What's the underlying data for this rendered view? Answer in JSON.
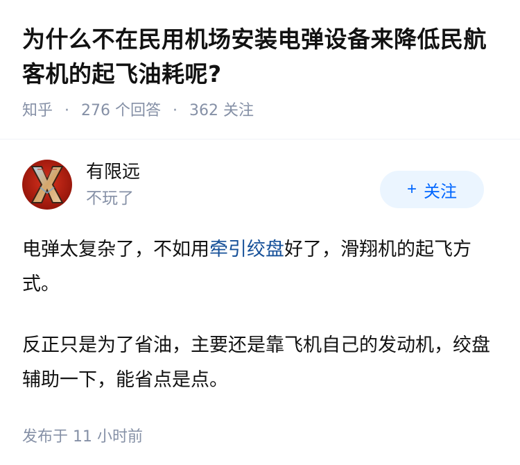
{
  "question": {
    "title": "为什么不在民用机场安装电弹设备来降低民航客机的起飞油耗呢?",
    "source": "知乎",
    "answer_count": "276 个回答",
    "follow_count": "362 关注"
  },
  "author": {
    "name": "有限远",
    "bio": "不玩了",
    "follow_label": "关注",
    "follow_icon": "plus-icon"
  },
  "content": {
    "p1_before": "电弹太复杂了，不如用",
    "p1_link": "牵引绞盘",
    "p1_after": "好了，滑翔机的起飞方式。",
    "p2": "反正只是为了省油，主要还是靠飞机自己的发动机，绞盘辅助一下，能省点是点。"
  },
  "footer": {
    "published": "发布于 11 小时前"
  },
  "colors": {
    "link": "#175199",
    "follow_text": "#0066ff",
    "follow_bg": "#ebf5ff",
    "meta": "#8590a6"
  }
}
